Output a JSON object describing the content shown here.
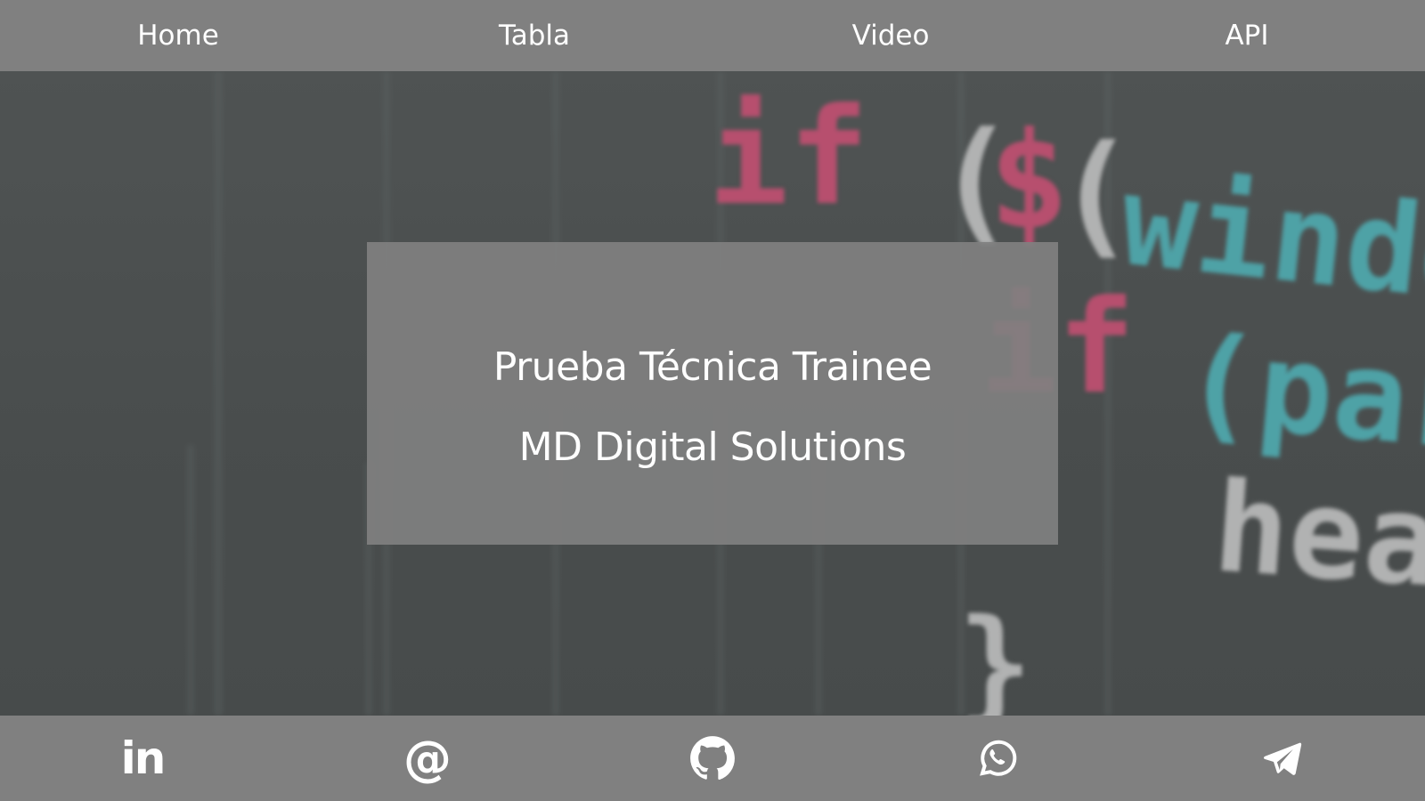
{
  "nav": {
    "items": [
      {
        "label": "Home",
        "name": "nav-home"
      },
      {
        "label": "Tabla",
        "name": "nav-tabla"
      },
      {
        "label": "Video",
        "name": "nav-video"
      },
      {
        "label": "API",
        "name": "nav-api"
      }
    ]
  },
  "hero": {
    "background_icon": "code-editor-photo",
    "code_snippets": [
      "if",
      "(",
      "$",
      "(",
      "windo",
      "if",
      "(pars",
      "head",
      "}"
    ],
    "card": {
      "line1": "Prueba Técnica Trainee",
      "line2": "MD Digital Solutions"
    }
  },
  "footer": {
    "links": [
      {
        "icon": "linkedin-icon",
        "label": "in"
      },
      {
        "icon": "email-at-icon",
        "label": "@"
      },
      {
        "icon": "github-icon"
      },
      {
        "icon": "whatsapp-icon"
      },
      {
        "icon": "telegram-icon"
      }
    ]
  },
  "colors": {
    "nav_bg": "#808080",
    "footer_bg": "#808080",
    "card_bg": "#808080",
    "hero_bg": "#4f5353",
    "code_pink": "#e0557e",
    "code_cyan": "#54c3c9",
    "code_white": "#d8d8d8",
    "text": "#ffffff"
  }
}
